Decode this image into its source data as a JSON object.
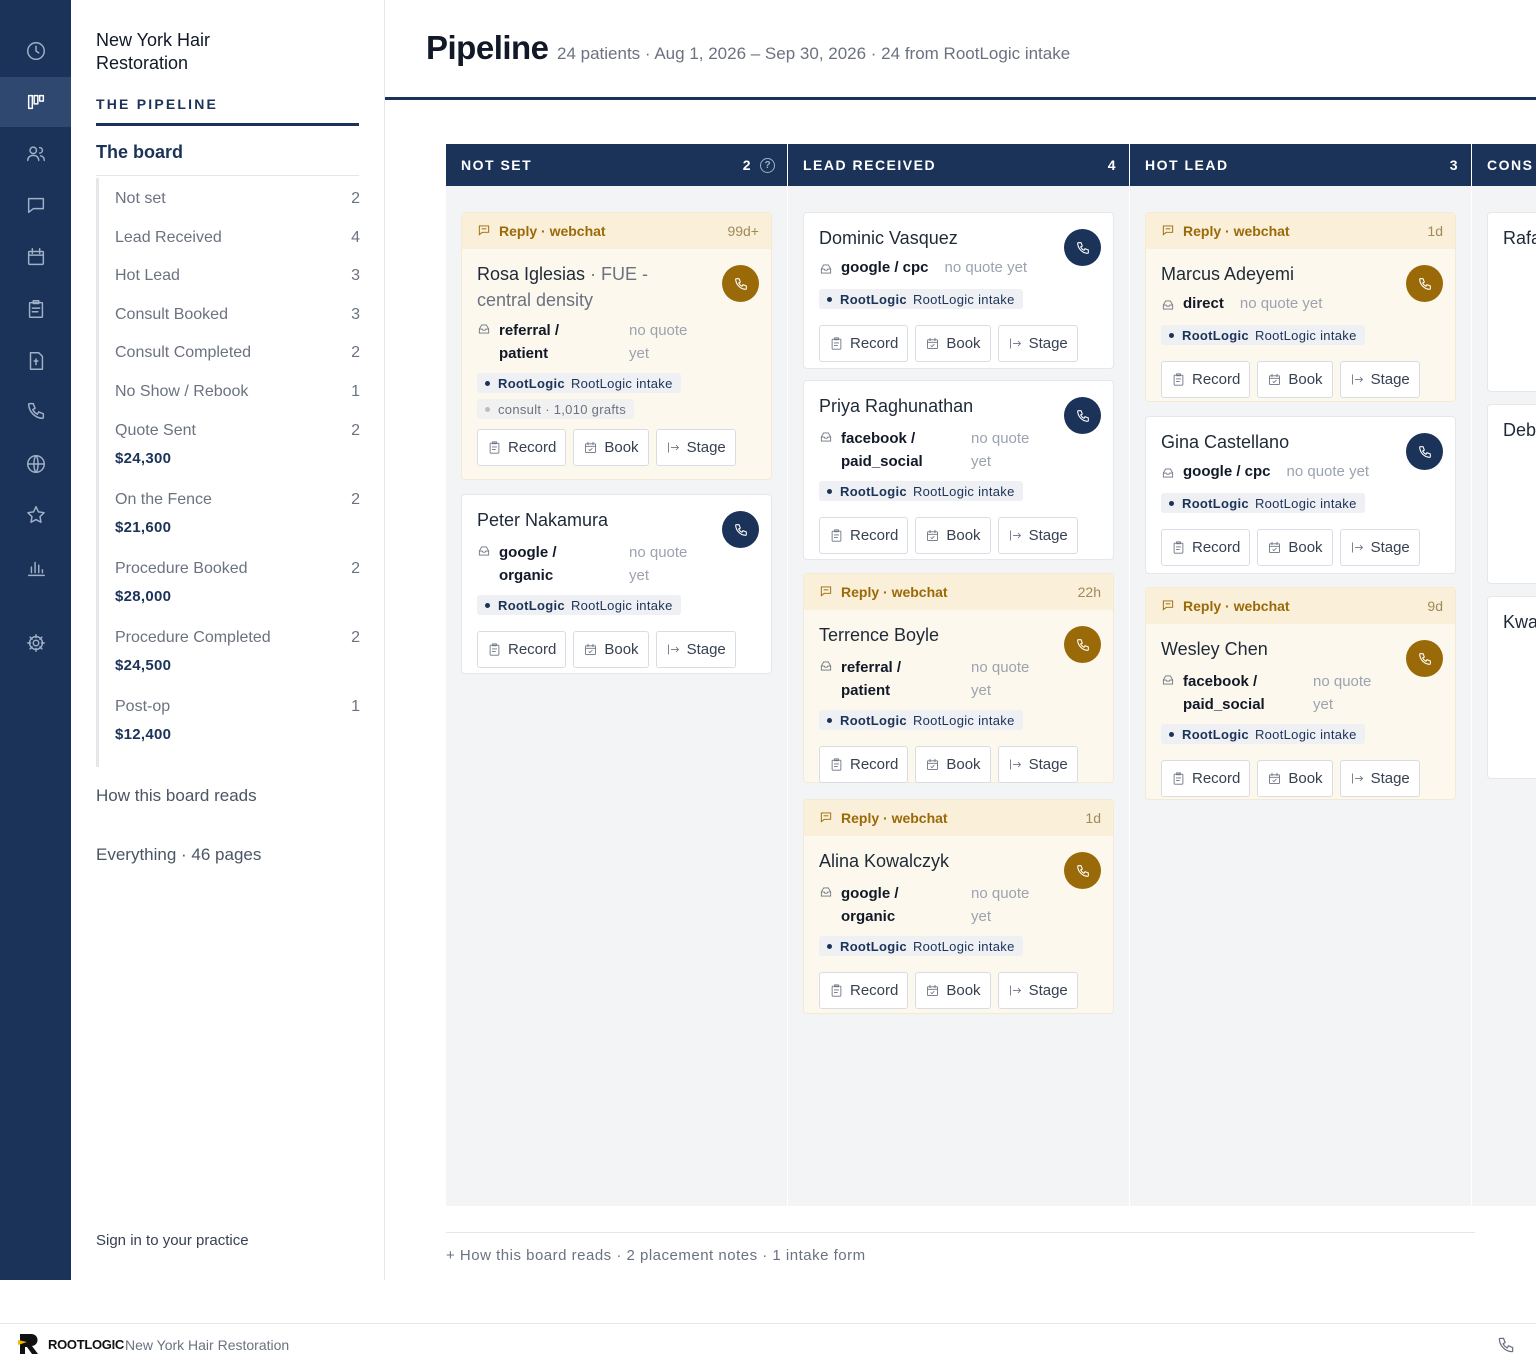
{
  "practice": {
    "name": "New York Hair Restoration"
  },
  "sidebar": {
    "section_label": "THE PIPELINE",
    "board_link": "The board",
    "stages": [
      {
        "label": "Not set",
        "count": "2",
        "value": ""
      },
      {
        "label": "Lead Received",
        "count": "4",
        "value": ""
      },
      {
        "label": "Hot Lead",
        "count": "3",
        "value": ""
      },
      {
        "label": "Consult Booked",
        "count": "3",
        "value": ""
      },
      {
        "label": "Consult Completed",
        "count": "2",
        "value": ""
      },
      {
        "label": "No Show / Rebook",
        "count": "1",
        "value": ""
      },
      {
        "label": "Quote Sent",
        "count": "2",
        "value": "$24,300"
      },
      {
        "label": "On the Fence",
        "count": "2",
        "value": "$21,600"
      },
      {
        "label": "Procedure Booked",
        "count": "2",
        "value": "$28,000"
      },
      {
        "label": "Procedure Completed",
        "count": "2",
        "value": "$24,500"
      },
      {
        "label": "Post-op",
        "count": "1",
        "value": "$12,400"
      }
    ],
    "how_link": "How this board reads",
    "everything_link": "Everything · 46 pages",
    "sign_in": "Sign in to your practice"
  },
  "header": {
    "title": "Pipeline",
    "subtitle": "24 patients · Aug 1, 2026 – Sep 30, 2026 · 24 from RootLogic intake"
  },
  "rail": {
    "icons": [
      "clock-icon",
      "board-icon",
      "people-icon",
      "chat-icon",
      "calendar-icon",
      "clipboard-icon",
      "document-icon",
      "phone-icon",
      "globe-icon",
      "star-icon",
      "chart-icon",
      "gear-icon"
    ]
  },
  "buttons": {
    "record": "Record",
    "book": "Book",
    "stage": "Stage"
  },
  "tag": {
    "bold": "RootLogic",
    "text": "RootLogic intake"
  },
  "columns": [
    {
      "title": "NOT SET",
      "count": "2",
      "cards": [
        {
          "reply": "Reply · webchat",
          "age": "99d+",
          "name": "Rosa Iglesias",
          "proc": " · FUE - central density",
          "src": "referral / patient",
          "quote": "no quote yet",
          "extra": "consult · 1,010 grafts"
        },
        {
          "name": "Peter Nakamura",
          "src": "google / organic",
          "quote": "no quote yet"
        }
      ]
    },
    {
      "title": "LEAD RECEIVED",
      "count": "4",
      "cards": [
        {
          "name": "Dominic Vasquez",
          "src": "google / cpc",
          "quote": "no quote yet"
        },
        {
          "name": "Priya Raghunathan",
          "src": "facebook / paid_social",
          "quote": "no quote yet"
        },
        {
          "reply": "Reply · webchat",
          "age": "22h",
          "name": "Terrence Boyle",
          "src": "referral / patient",
          "quote": "no quote yet"
        },
        {
          "reply": "Reply · webchat",
          "age": "1d",
          "name": "Alina Kowalczyk",
          "src": "google / organic",
          "quote": "no quote yet"
        }
      ]
    },
    {
      "title": "HOT LEAD",
      "count": "3",
      "cards": [
        {
          "reply": "Reply · webchat",
          "age": "1d",
          "name": "Marcus Adeyemi",
          "src": "direct",
          "quote": "no quote yet"
        },
        {
          "name": "Gina Castellano",
          "src": "google / cpc",
          "quote": "no quote yet"
        },
        {
          "reply": "Reply · webchat",
          "age": "9d",
          "name": "Wesley Chen",
          "src": "facebook / paid_social",
          "quote": "no quote yet"
        }
      ]
    },
    {
      "title": "CONS",
      "cards": [
        {
          "name": "Rafa"
        },
        {
          "name": "Deb"
        },
        {
          "name": "Kwa"
        }
      ]
    }
  ],
  "footer_note": "+ How this board reads · 2 placement notes · 1 intake form",
  "bottombar": {
    "brand": "ROOTLOGIC",
    "separator": "·",
    "practice": "New York Hair Restoration"
  }
}
